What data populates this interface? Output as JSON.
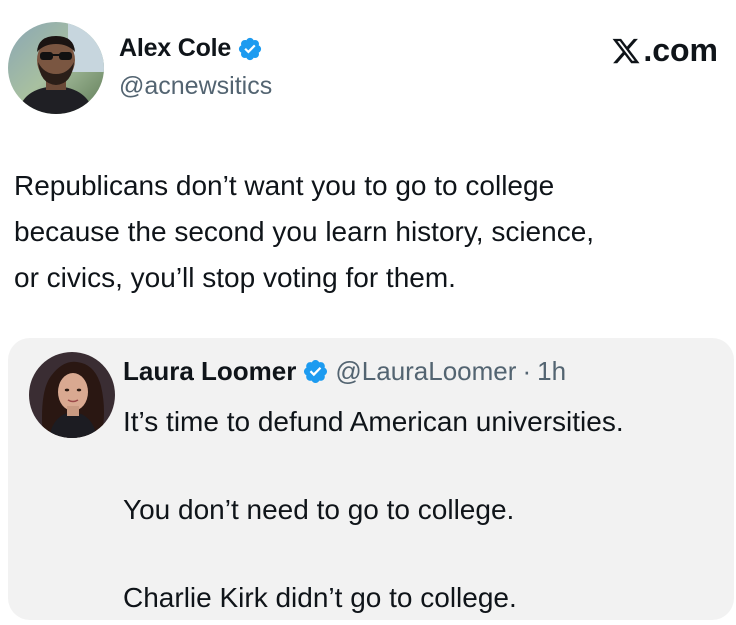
{
  "author": {
    "name": "Alex Cole",
    "handle": "@acnewsitics"
  },
  "brand": {
    "label": ".com",
    "icon": "x-logo-icon"
  },
  "tweet": {
    "lines": [
      "Republicans don’t want you to go to college",
      "because the second you learn history, science,",
      "or civics, you’ll stop voting for them."
    ]
  },
  "quote": {
    "name": "Laura Loomer",
    "handle": "@LauraLoomer",
    "separator": "·",
    "time": "1h",
    "paragraphs": [
      "It’s time to defund American universities.",
      "You don’t need to go to college.",
      "Charlie Kirk didn’t go to college."
    ]
  },
  "colors": {
    "verified_blue": "#1d9bf0",
    "handle_gray": "#536471",
    "quote_bg": "#f2f2f2"
  }
}
